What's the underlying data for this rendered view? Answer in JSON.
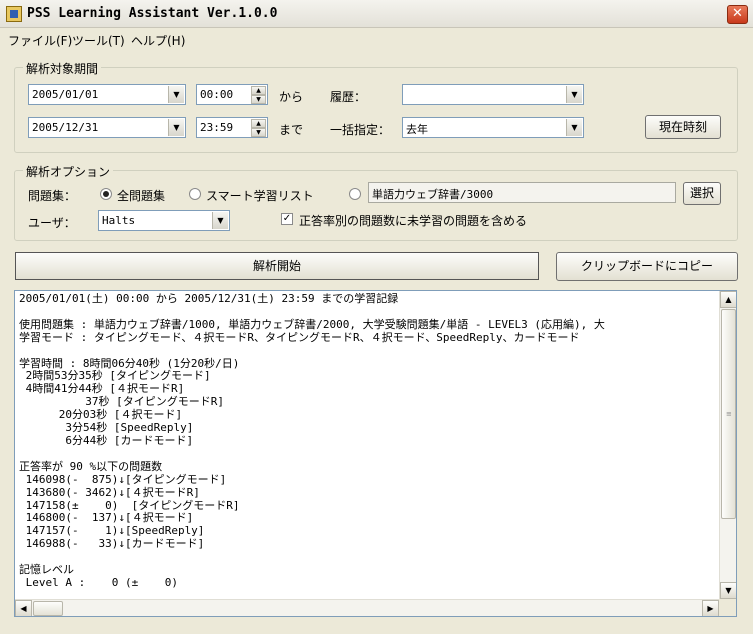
{
  "window": {
    "title": "PSS Learning Assistant Ver.1.0.0",
    "close_glyph": "✕"
  },
  "menu": [
    "ファイル(F)",
    "ツール(T)",
    "ヘルプ(H)"
  ],
  "period": {
    "group_title": "解析対象期間",
    "start_date": "2005/01/01",
    "start_time": "00:00",
    "from_label": "から",
    "end_date": "2005/12/31",
    "end_time": "23:59",
    "until_label": "まで",
    "history_label": "履歴：",
    "history_value": "",
    "batch_label": "一括指定：",
    "batch_value": "去年",
    "now_button": "現在時刻"
  },
  "options": {
    "group_title": "解析オプション",
    "problemset_label": "問題集：",
    "radio_all": "全問題集",
    "radio_smart": "スマート学習リスト",
    "selected_set": "単語力ウェブ辞書/3000",
    "select_button": "選択",
    "user_label": "ユーザ：",
    "user_value": "Halts",
    "include_unlearned": "正答率別の問題数に未学習の問題を含める",
    "include_checked": true,
    "selected_radio": "all"
  },
  "actions": {
    "start_button": "解析開始",
    "copy_button": "クリップボードにコピー"
  },
  "output": {
    "lines": [
      "2005/01/01(土) 00:00 から 2005/12/31(土) 23:59 までの学習記録",
      "",
      "使用問題集 : 単語力ウェブ辞書/1000, 単語力ウェブ辞書/2000, 大学受験問題集/単語 - LEVEL3 (応用編), 大",
      "学習モード : タイピングモード、４択モードR、タイピングモードR、４択モード、SpeedReply、カードモード",
      "",
      "学習時間 : 8時間06分40秒 (1分20秒/日)",
      " 2時間53分35秒 [タイピングモード]",
      " 4時間41分44秒 [４択モードR]",
      "          37秒 [タイピングモードR]",
      "      20分03秒 [４択モード]",
      "       3分54秒 [SpeedReply]",
      "       6分44秒 [カードモード]",
      "",
      "正答率が 90 %以下の問題数",
      " 146098(-  875)↓[タイピングモード]",
      " 143680(- 3462)↓[４択モードR]",
      " 147158(±    0)  [タイピングモードR]",
      " 146800(-  137)↓[４択モード]",
      " 147157(-    1)↓[SpeedReply]",
      " 146988(-   33)↓[カードモード]",
      "",
      "記憶レベル",
      " Level A :    0 (±    0)"
    ]
  }
}
